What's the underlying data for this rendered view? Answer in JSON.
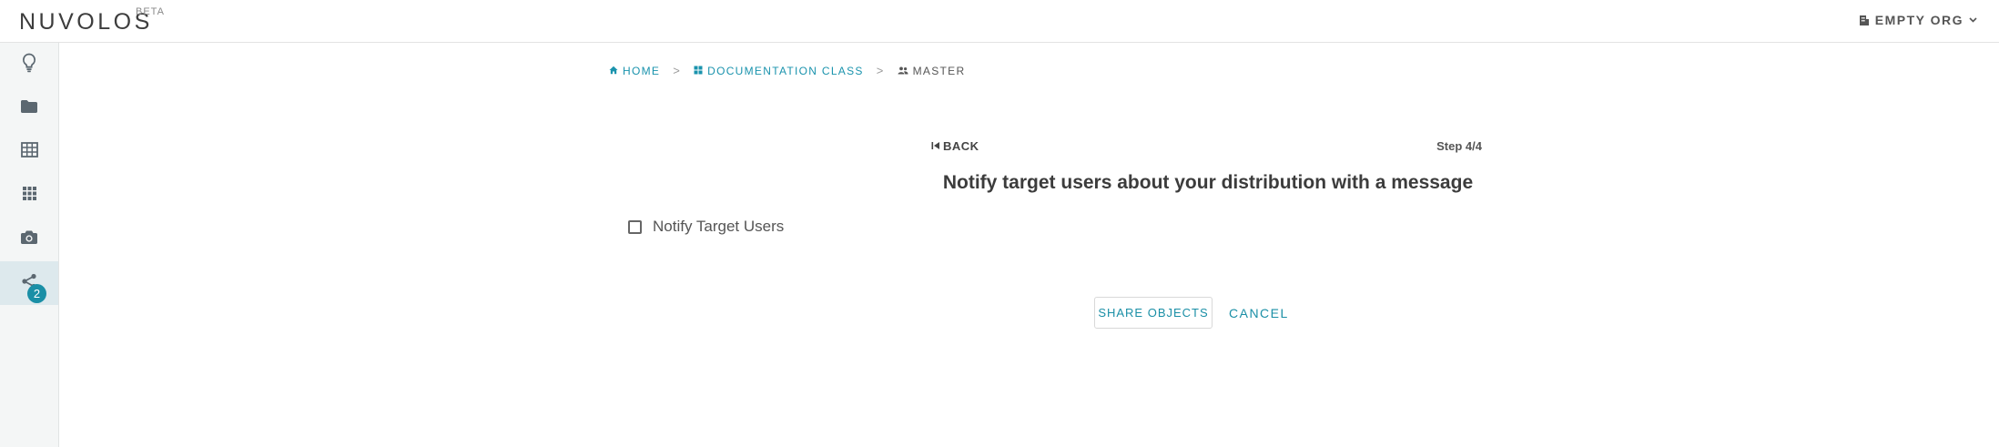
{
  "header": {
    "brand": "NUVOLOS",
    "brand_badge": "BETA",
    "org_label": "EMPTY ORG"
  },
  "sidebar": {
    "items": [
      {
        "icon": "lightbulb-icon"
      },
      {
        "icon": "folder-icon"
      },
      {
        "icon": "table-icon"
      },
      {
        "icon": "apps-grid-icon"
      },
      {
        "icon": "camera-icon"
      },
      {
        "icon": "share-icon",
        "badge": "2",
        "active": true
      }
    ]
  },
  "breadcrumb": {
    "home": "HOME",
    "class": "DOCUMENTATION CLASS",
    "instance": "MASTER",
    "separator": ">"
  },
  "wizard": {
    "back_label": "BACK",
    "step": "Step 4/4",
    "heading": "Notify target users about your distribution with a message",
    "checkbox_label": "Notify Target Users",
    "checkbox_checked": false,
    "share_button": "SHARE OBJECTS",
    "cancel_button": "CANCEL"
  },
  "colors": {
    "accent": "#1a8fa6",
    "sidebar_bg": "#f4f6f6",
    "sidebar_active_bg": "#dde9ed"
  }
}
